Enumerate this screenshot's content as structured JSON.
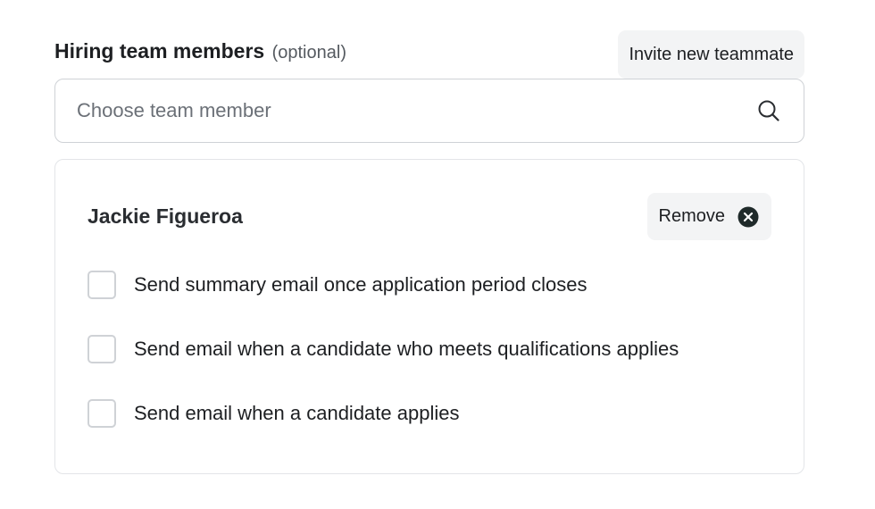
{
  "hiring_team": {
    "title": "Hiring team members",
    "optional_label": "(optional)",
    "invite_button_label": "Invite new teammate",
    "search": {
      "placeholder": "Choose team member",
      "value": "",
      "icon": "search-icon"
    }
  },
  "member": {
    "name": "Jackie Figueroa",
    "remove_label": "Remove",
    "remove_icon": "close-circle-icon",
    "options": [
      {
        "label": "Send summary email once application period closes",
        "checked": false
      },
      {
        "label": "Send email when a candidate who meets qualifications applies",
        "checked": false
      },
      {
        "label": "Send email when a candidate applies",
        "checked": false
      }
    ]
  },
  "colors": {
    "border": "#cfd2d6",
    "card_border": "#e3e5e8",
    "button_bg": "#f3f4f5",
    "text": "#1d1f22",
    "muted_text": "#555a60",
    "icon_dark": "#1f2a2a"
  }
}
